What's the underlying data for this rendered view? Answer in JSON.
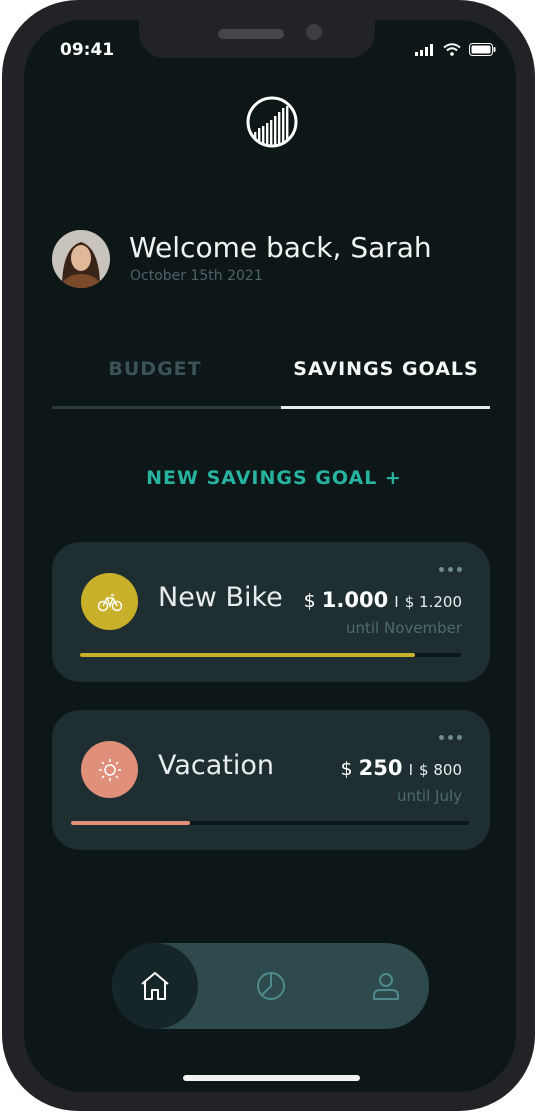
{
  "status_bar": {
    "time": "09:41"
  },
  "header": {
    "welcome": "Welcome back, Sarah",
    "date": "October 15th 2021"
  },
  "tabs": [
    {
      "label": "BUDGET",
      "active": false
    },
    {
      "label": "SAVINGS GOALS",
      "active": true
    }
  ],
  "new_goal_label": "NEW SAVINGS GOAL +",
  "goals": [
    {
      "name": "New Bike",
      "currency": "$",
      "current": "1.000",
      "separator": "I",
      "target": "$ 1.200",
      "until": "until November",
      "progress": 0.88,
      "color": "#c9b02a",
      "icon": "bike-icon"
    },
    {
      "name": "Vacation",
      "currency": "$",
      "current": "250",
      "separator": "I",
      "target": "$ 800",
      "until": "until July",
      "progress": 0.3,
      "color": "#e0907a",
      "icon": "sun-icon"
    }
  ],
  "nav": {
    "items": [
      "home-icon",
      "chart-pie-icon",
      "profile-icon"
    ],
    "active": "home-icon"
  },
  "colors": {
    "accent": "#27b3a0",
    "background": "#0d1718",
    "card": "#1f2f31"
  }
}
